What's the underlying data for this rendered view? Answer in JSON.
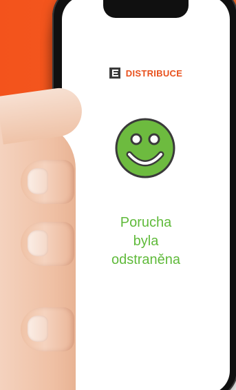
{
  "logo": {
    "brand_text": "DISTRIBUCE",
    "mark_icon": "cez-logo-mark"
  },
  "status": {
    "icon": "smiley-face-icon",
    "line1": "Porucha",
    "line2": "byla",
    "line3": "odstraněna"
  },
  "colors": {
    "background_accent": "#f3531c",
    "brand_orange": "#e8501c",
    "success_green": "#5fba3a",
    "smiley_fill": "#6dbb3f"
  }
}
